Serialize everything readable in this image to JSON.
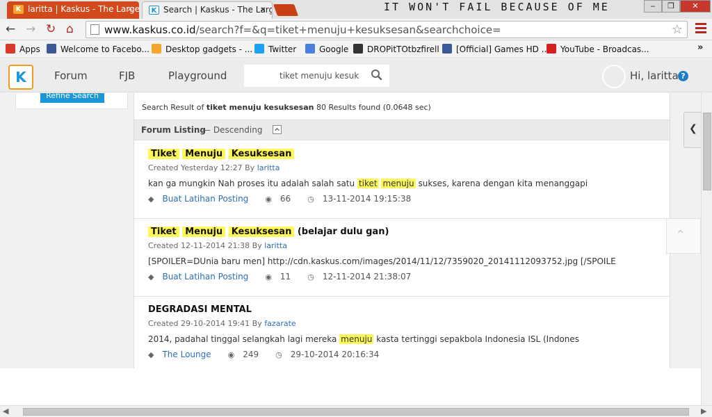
{
  "tabs": [
    {
      "title": "laritta | Kaskus - The Large",
      "close": "×"
    },
    {
      "title": "Search | Kaskus - The Larg",
      "close": "×"
    }
  ],
  "window_title_text": "IT WON'T FAIL BECAUSE OF ME",
  "window_controls": {
    "minimize": "‒",
    "maximize": "❐",
    "close": "✕"
  },
  "nav": {
    "back": "←",
    "forward": "→",
    "reload": "↻",
    "home": "⌂"
  },
  "address": {
    "host": "www.kaskus.co.id",
    "path": "/search?f=&q=tiket+menuju+kesuksesan&searchchoice="
  },
  "bookmarks": [
    {
      "label": "Apps",
      "icon": "apps-icon",
      "color": "#d8392b"
    },
    {
      "label": "Welcome to Facebo...",
      "icon": "facebook-icon",
      "color": "#3b5998"
    },
    {
      "label": "Desktop gadgets - ...",
      "icon": "windows-icon",
      "color": "#f3a62b"
    },
    {
      "label": "Twitter",
      "icon": "twitter-icon",
      "color": "#1da1f2"
    },
    {
      "label": "Google",
      "icon": "google-icon",
      "color": "#4a7fe0"
    },
    {
      "label": "DROPitTOtbzfirell",
      "icon": "dropbox-icon",
      "color": "#333333"
    },
    {
      "label": "[Official] Games HD ...",
      "icon": "facebook-icon",
      "color": "#3b5998"
    },
    {
      "label": "YouTube - Broadcas...",
      "icon": "youtube-icon",
      "color": "#d61f1f"
    }
  ],
  "bookmarks_more": "»",
  "site": {
    "logo": "K",
    "nav": [
      "Forum",
      "FJB",
      "Playground"
    ],
    "search_value": "tiket menuju kesuk",
    "greeting": "Hi, laritta",
    "help": "?"
  },
  "sidebar": {
    "refine_button": "Refine Search"
  },
  "summary": {
    "prefix": "Search Result of",
    "query": "tiket menuju kesuksesan",
    "suffix": "80 Results found (0.0648 sec)"
  },
  "listing": {
    "title": "Forum Listing",
    "sort": "— Descending"
  },
  "results": [
    {
      "title_words": [
        "Tiket",
        "Menuju",
        "Kesuksesan"
      ],
      "title_rest": "",
      "highlighted": true,
      "created": "Created Yesterday 12:27 By",
      "author": "laritta",
      "snippet_before": "kan ga mungkin Nah proses itu adalah salah satu",
      "snippet_hl": [
        "tiket",
        "menuju"
      ],
      "snippet_after": "sukses, karena dengan kita menanggapi",
      "forum": "Buat Latihan Posting",
      "views": "66",
      "date": "13-11-2014 19:15:38"
    },
    {
      "title_words": [
        "Tiket",
        "Menuju",
        "Kesuksesan"
      ],
      "title_rest": "(belajar dulu gan)",
      "highlighted": true,
      "created": "Created 12-11-2014 21:38 By",
      "author": "laritta",
      "snippet_before": "[SPOILER=DUnia baru men] http://cdn.kaskus.com/images/2014/11/12/7359020_20141112093752.jpg [/SPOILE",
      "snippet_hl": [],
      "snippet_after": "",
      "forum": "Buat Latihan Posting",
      "views": "11",
      "date": "12-11-2014 21:38:07"
    },
    {
      "title_words": [],
      "title_rest": "DEGRADASI MENTAL",
      "highlighted": false,
      "created": "Created 29-10-2014 19:41 By",
      "author": "fazarate",
      "snippet_before": "2014, padahal tinggal selangkah lagi mereka",
      "snippet_hl": [
        "menuju"
      ],
      "snippet_after": "kasta tertinggi sepakbola Indonesia ISL (Indones",
      "forum": "The Lounge",
      "views": "249",
      "date": "29-10-2014 20:16:34"
    }
  ]
}
